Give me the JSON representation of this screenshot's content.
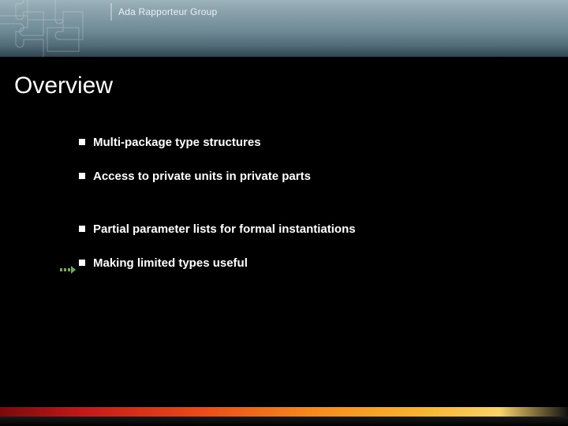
{
  "header": {
    "group_label": "Ada Rapporteur Group"
  },
  "title": "Overview",
  "bullets": [
    {
      "text": "Multi-package type structures",
      "highlighted": false
    },
    {
      "text": "Access to private units in private parts",
      "highlighted": false
    },
    {
      "text": "Partial parameter lists for formal instantiations",
      "highlighted": false
    },
    {
      "text": "Making limited types useful",
      "highlighted": true
    }
  ],
  "colors": {
    "background": "#000000",
    "header_gradient_top": "#9db3bb",
    "header_gradient_bottom": "#304550",
    "text": "#ffffff",
    "footer_gradient": [
      "#7a0a0a",
      "#c21a1a",
      "#e84a1a",
      "#f58a1e",
      "#f7b733",
      "#f9d36b"
    ]
  }
}
